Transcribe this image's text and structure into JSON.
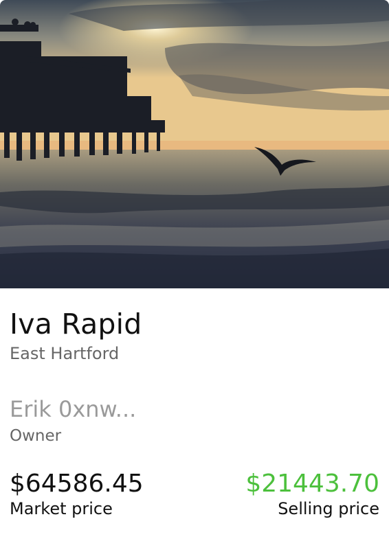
{
  "listing": {
    "image_alt": "Sunset over a pier with a seagull flying above the water",
    "title": "Iva Rapid",
    "location": "East Hartford",
    "owner_name": "Erik 0xnw...",
    "owner_role": "Owner",
    "market_price": "$64586.45",
    "market_price_label": "Market price",
    "selling_price": "$21443.70",
    "selling_price_label": "Selling price"
  },
  "colors": {
    "selling_price": "#4cc03c",
    "title": "#111111",
    "muted": "#666666",
    "owner": "#9a9a9a"
  }
}
